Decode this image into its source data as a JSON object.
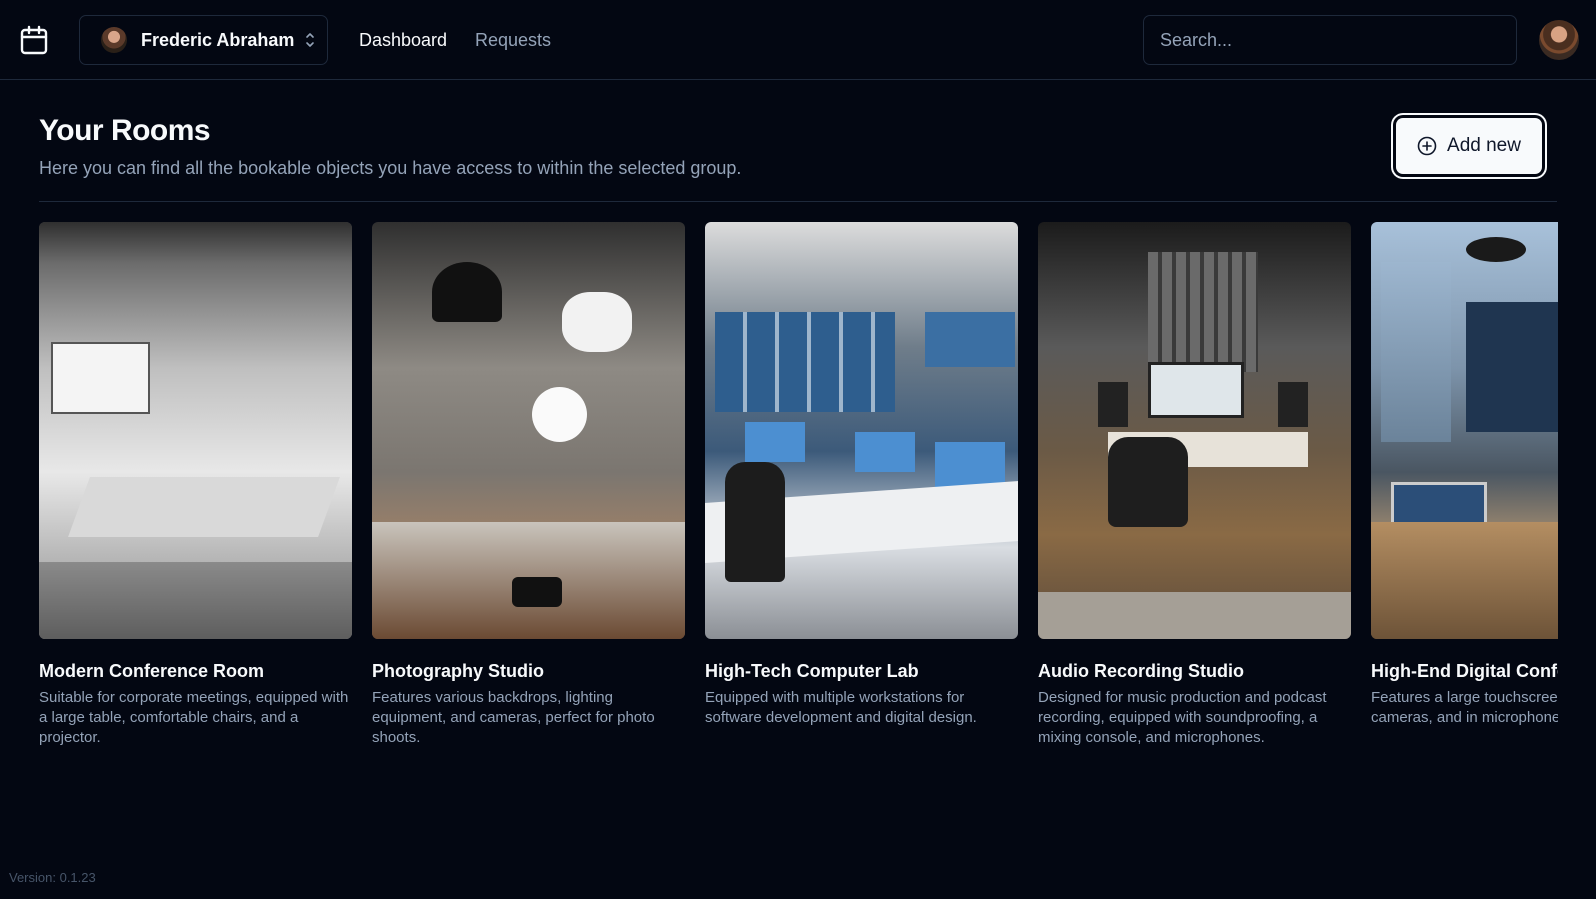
{
  "header": {
    "group_name": "Frederic Abraham",
    "nav": [
      {
        "label": "Dashboard",
        "active": true
      },
      {
        "label": "Requests",
        "active": false
      }
    ],
    "search": {
      "placeholder": "Search..."
    },
    "icons": {
      "app": "calendar-icon",
      "switcher": "chevrons-up-down-icon"
    }
  },
  "main": {
    "title": "Your Rooms",
    "subtitle": "Here you can find all the bookable objects you have access to within the selected group.",
    "add_button_label": "Add new",
    "add_button_icon": "plus-circle-icon",
    "rooms": [
      {
        "name": "Modern Conference Room",
        "description": "Suitable for corporate meetings, equipped with a large table, comfortable chairs, and a projector."
      },
      {
        "name": "Photography Studio",
        "description": "Features various backdrops, lighting equipment, and cameras, perfect for photo shoots."
      },
      {
        "name": "High-Tech Computer Lab",
        "description": "Equipped with multiple workstations for software development and digital design."
      },
      {
        "name": "Audio Recording Studio",
        "description": "Designed for music production and podcast recording, equipped with soundproofing, a mixing console, and microphones."
      },
      {
        "name": "High-End Digital Confer",
        "description": "Features a large touchscreen conferencing cameras, and in microphones, ideal for virtua"
      }
    ]
  },
  "footer": {
    "version": "Version: 0.1.23"
  },
  "colors": {
    "background": "#030712",
    "border": "#1e293b",
    "muted_text": "#94a3b8",
    "primary_text": "#f8fafc"
  }
}
